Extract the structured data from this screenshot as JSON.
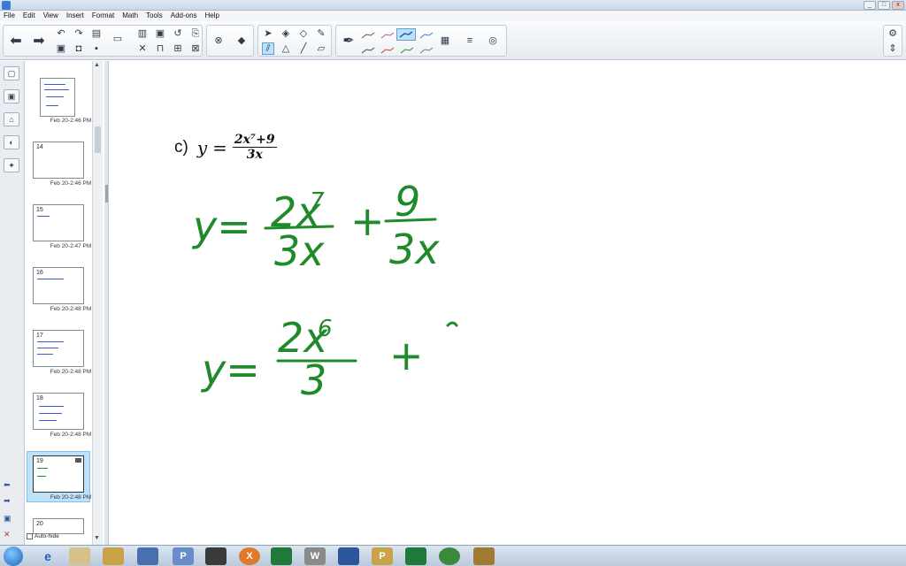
{
  "window": {
    "title": "",
    "buttons": [
      "_",
      "□",
      "x"
    ]
  },
  "menu": [
    "File",
    "Edit",
    "View",
    "Insert",
    "Format",
    "Math",
    "Tools",
    "Add-ons",
    "Help"
  ],
  "sorter": {
    "thumbnails": [
      {
        "number": "",
        "label": "Feb 20-2:46 PM"
      },
      {
        "number": "14",
        "label": "Feb 20-2:46 PM"
      },
      {
        "number": "15",
        "label": "Feb 20-2:47 PM"
      },
      {
        "number": "16",
        "label": "Feb 20-2:48 PM"
      },
      {
        "number": "17",
        "label": "Feb 20-2:48 PM"
      },
      {
        "number": "18",
        "label": "Feb 20-2:48 PM"
      },
      {
        "number": "19",
        "label": "Feb 20-2:48 PM"
      },
      {
        "number": "20",
        "label": ""
      }
    ],
    "selected_index": 6,
    "autohide_label": "Auto-hide"
  },
  "canvas": {
    "part_label": "c)",
    "typed_var": "y",
    "typed_eq": "=",
    "typed_num": "2x⁷+9",
    "typed_den": "3x",
    "hand_line1": {
      "lhs": "y=",
      "frac1_num": "2x",
      "frac1_exp": "7",
      "frac1_den": "3x",
      "plus": "+",
      "frac2_num": "9",
      "frac2_den": "3x"
    },
    "hand_line2": {
      "lhs": "y=",
      "frac_num": "2x",
      "frac_exp": "6",
      "frac_den": "3",
      "plus": "+"
    }
  },
  "taskbar": {
    "apps": [
      "e",
      "",
      "",
      "",
      "P",
      "",
      "X",
      "",
      "W",
      "",
      "P",
      "",
      "",
      ""
    ],
    "time": "",
    "date": ""
  },
  "colors": {
    "ink_green": "#1e8a2a",
    "accent": "#5aa2d6"
  }
}
